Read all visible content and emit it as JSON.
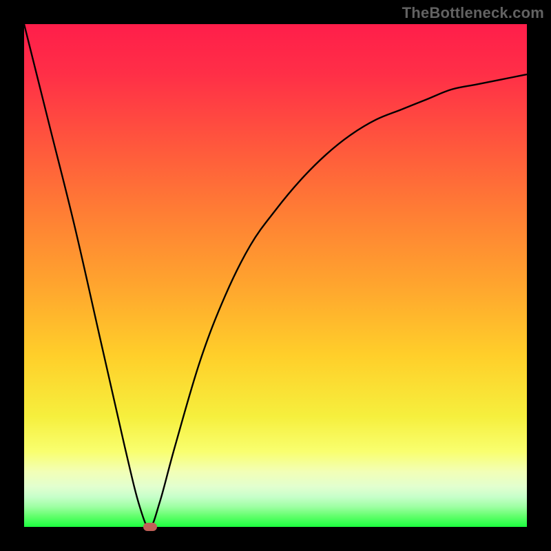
{
  "attribution": "TheBottleneck.com",
  "chart_data": {
    "type": "line",
    "title": "",
    "xlabel": "",
    "ylabel": "",
    "xlim": [
      0,
      100
    ],
    "ylim": [
      0,
      100
    ],
    "background_gradient": {
      "top": "#ff1e4a",
      "mid": "#ffcf2a",
      "bottom": "#1cff3f"
    },
    "series": [
      {
        "name": "bottleneck-curve",
        "x": [
          0,
          5,
          10,
          15,
          20,
          23,
          25,
          27,
          30,
          35,
          40,
          45,
          50,
          55,
          60,
          65,
          70,
          75,
          80,
          85,
          90,
          95,
          100
        ],
        "values": [
          100,
          80,
          60,
          38,
          16,
          4,
          0,
          5,
          16,
          33,
          46,
          56,
          63,
          69,
          74,
          78,
          81,
          83,
          85,
          87,
          88,
          89,
          90
        ]
      }
    ],
    "marker": {
      "x": 25,
      "y": 0,
      "color": "#c06058"
    }
  }
}
